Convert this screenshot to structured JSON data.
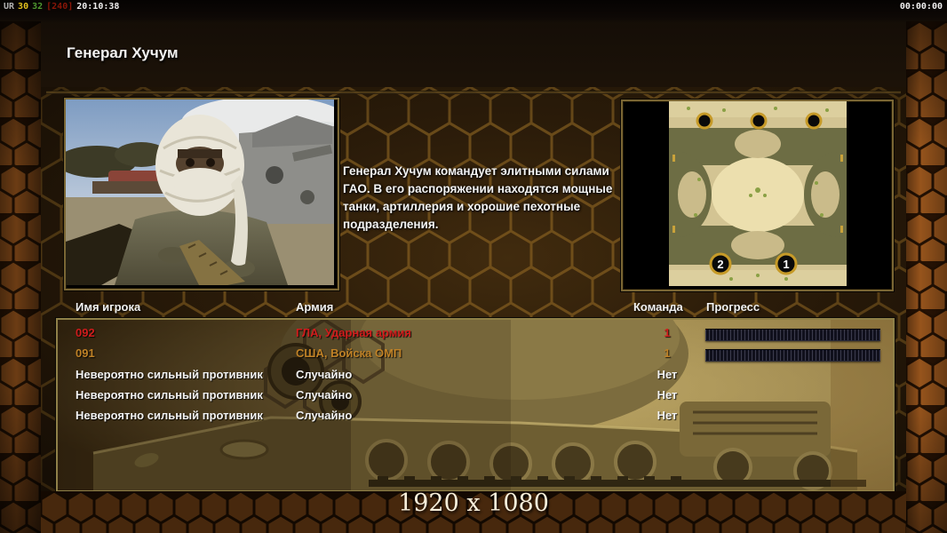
{
  "topbar": {
    "debug": {
      "label": "UR",
      "fps": "30",
      "val2": "32",
      "val3": "[240]",
      "time": "20:10:38"
    },
    "match_timer": "00:00:00"
  },
  "dialog": {
    "title": "Генерал Хучум"
  },
  "general_info": {
    "description": "Генерал Хучум командует элитными силами ГАО. В его распоряжении находятся мощные танки, артиллерия и хорошие пехотные подразделения."
  },
  "map_preview": {
    "start_positions": [
      {
        "label": "2"
      },
      {
        "label": "1"
      }
    ]
  },
  "player_table": {
    "columns": {
      "name": "Имя игрока",
      "army": "Армия",
      "team": "Команда",
      "progress": "Прогресс"
    },
    "rows": [
      {
        "name": "092",
        "army": "ГЛА, Ударная армия",
        "team": "1",
        "color": "#d01c1c",
        "progress_percent": 0
      },
      {
        "name": "091",
        "army": "США, Войска ОМП",
        "team": "1",
        "color": "#bf8126",
        "progress_percent": 0
      },
      {
        "name": "Невероятно сильный противник",
        "army": "Случайно",
        "team": "Нет",
        "color": "#f2f2f2"
      },
      {
        "name": "Невероятно сильный противник",
        "army": "Случайно",
        "team": "Нет",
        "color": "#f2f2f2"
      },
      {
        "name": "Невероятно сильный противник",
        "army": "Случайно",
        "team": "Нет",
        "color": "#f2f2f2"
      }
    ]
  },
  "footer": {
    "resolution": "1920 x 1080"
  },
  "theme": {
    "accent_gold": "#b8862e",
    "player_red": "#d01c1c",
    "player_orange": "#bf8126",
    "text": "#f2f2f2"
  }
}
